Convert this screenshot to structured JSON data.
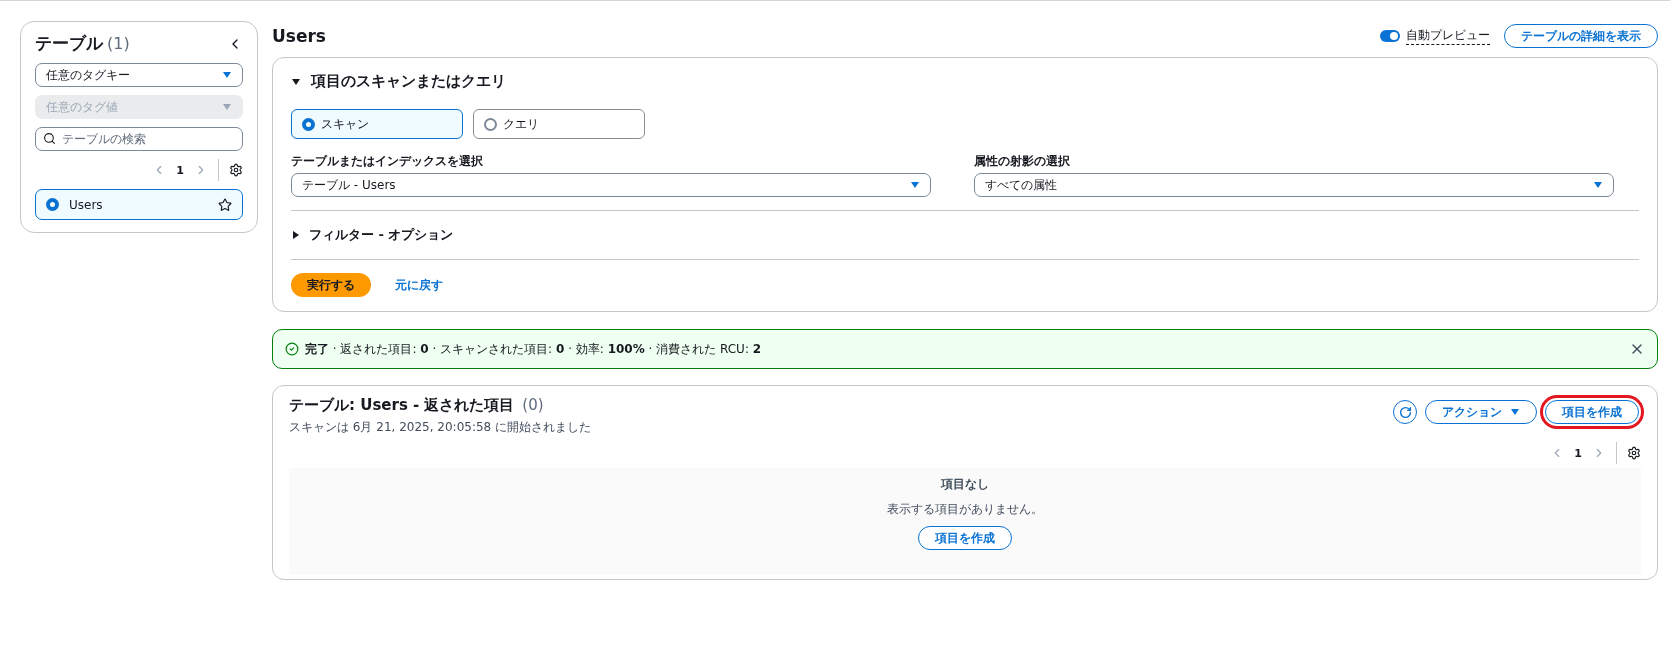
{
  "sidebar": {
    "title": "テーブル",
    "count": "(1)",
    "tag_key": {
      "value": "任意のタグキー",
      "disabled": false
    },
    "tag_value": {
      "placeholder": "任意のタグ値",
      "disabled": true
    },
    "search": {
      "placeholder": "テーブルの検索"
    },
    "pagination": {
      "page": "1"
    },
    "tables": [
      {
        "name": "Users",
        "selected": true,
        "favorite": false
      }
    ]
  },
  "header": {
    "title": "Users",
    "auto_preview": {
      "label": "自動プレビュー",
      "on": true
    },
    "details_button": "テーブルの詳細を表示"
  },
  "scan_panel": {
    "title": "項目のスキャンまたはクエリ",
    "expanded": true,
    "modes": [
      {
        "label": "スキャン",
        "selected": true
      },
      {
        "label": "クエリ",
        "selected": false
      }
    ],
    "table_select": {
      "label": "テーブルまたはインデックスを選択",
      "value": "テーブル - Users"
    },
    "projection_select": {
      "label": "属性の射影の選択",
      "value": "すべての属性"
    },
    "filter": {
      "label": "フィルター - オプション",
      "expanded": false
    },
    "run_button": "実行する",
    "reset_link": "元に戻す"
  },
  "alert": {
    "kind": "success",
    "text": "**完了** · 返された項目: **0** · スキャンされた項目: **0** · 効率: **100%** · 消費された RCU: **2**"
  },
  "results": {
    "title": "テーブル: Users - 返された項目",
    "count": "(0)",
    "subtitle": "スキャンは 6月 21, 2025, 20:05:58 に開始されました",
    "actions_button": "アクション",
    "create_button": {
      "label": "項目を作成",
      "highlighted": true
    },
    "pagination": {
      "page": "1"
    },
    "empty": {
      "title": "項目なし",
      "message": "表示する項目がありません。",
      "button": "項目を作成"
    }
  }
}
